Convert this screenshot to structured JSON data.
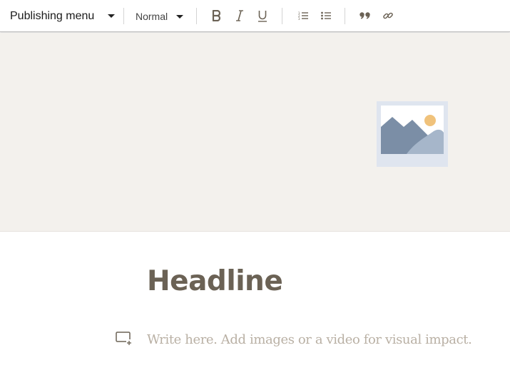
{
  "toolbar": {
    "publishing_menu_label": "Publishing menu",
    "text_style_value": "Normal",
    "icons": [
      "chevron-down-icon",
      "bold-icon",
      "italic-icon",
      "underline-icon",
      "numbered-list-icon",
      "bulleted-list-icon",
      "quote-icon",
      "link-icon"
    ]
  },
  "cover": {
    "background": "#f3f1ed",
    "placeholder_icon": "image-placeholder-icon"
  },
  "article": {
    "headline": "Headline",
    "body_placeholder": "Write here. Add images or a video for visual impact.",
    "add_media_icon": "add-media-icon"
  },
  "colors": {
    "headline": "#6b6255",
    "placeholder_text": "#b9b0a4",
    "icon": "#6b6255"
  }
}
